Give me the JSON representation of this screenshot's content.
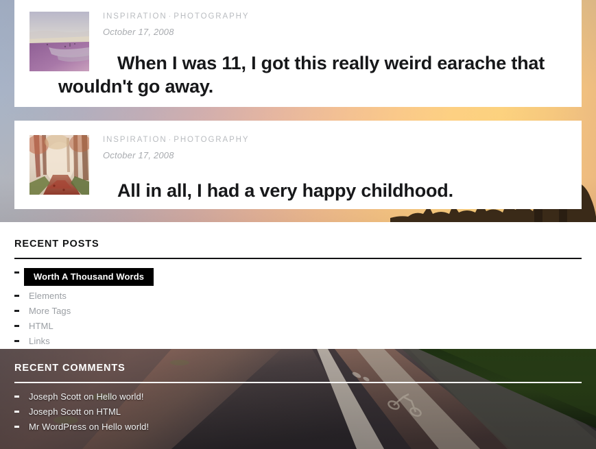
{
  "hero": {
    "background_description": "sunset sky photograph with tree and building silhouettes",
    "gradient_start": "#a7b4c8",
    "gradient_end": "#fdd083"
  },
  "posts": [
    {
      "categories": [
        "INSPIRATION",
        "PHOTOGRAPHY"
      ],
      "separator": "·",
      "date": "October 17, 2008",
      "title": "When I was 11, I got this really weird earache that wouldn't go away.",
      "title_line_1": "When I was 11, I got this really weird",
      "title_line_2": "earache that wouldn't go away.",
      "thumbnail": "beach-sunset-thumbnail"
    },
    {
      "categories": [
        "INSPIRATION",
        "PHOTOGRAPHY"
      ],
      "separator": "·",
      "date": "October 17, 2008",
      "title": "All in all, I had a very happy childhood.",
      "title_line_1": "All in all, I had a very happy childhood.",
      "title_line_2": "",
      "thumbnail": "autumn-forest-path-thumbnail"
    }
  ],
  "widgets": {
    "recent_posts": {
      "title": "RECENT POSTS",
      "items": [
        {
          "label": "Worth A Thousand Words",
          "active": true
        },
        {
          "label": "Elements",
          "active": false
        },
        {
          "label": "More Tags",
          "active": false
        },
        {
          "label": "HTML",
          "active": false
        },
        {
          "label": "Links",
          "active": false
        }
      ]
    },
    "recent_comments": {
      "title": "RECENT COMMENTS",
      "background_description": "bike lane road photograph at dusk",
      "items": [
        {
          "label": "Joseph Scott on Hello world!"
        },
        {
          "label": "Joseph Scott on HTML"
        },
        {
          "label": "Mr WordPress on Hello world!"
        }
      ]
    }
  },
  "colors": {
    "accent_active_bg": "#000000",
    "link_muted": "#9a9ea3",
    "meta_text": "#b9bcc0",
    "title_text": "#17181a"
  }
}
